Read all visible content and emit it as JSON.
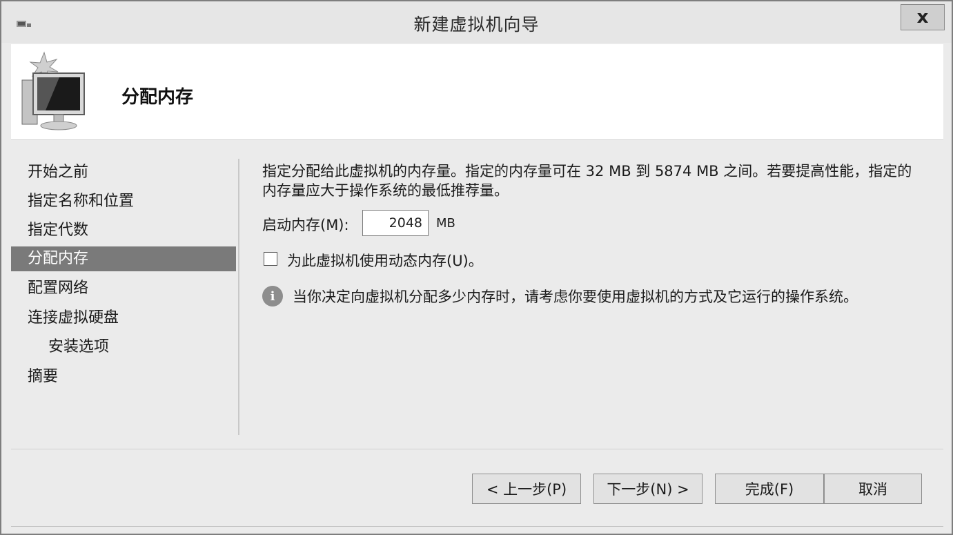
{
  "window": {
    "title": "新建虚拟机向导",
    "close_label": "x"
  },
  "header": {
    "title": "分配内存"
  },
  "nav": {
    "items": [
      {
        "label": "开始之前",
        "active": false,
        "sub": false
      },
      {
        "label": "指定名称和位置",
        "active": false,
        "sub": false
      },
      {
        "label": "指定代数",
        "active": false,
        "sub": false
      },
      {
        "label": "分配内存",
        "active": true,
        "sub": false
      },
      {
        "label": "配置网络",
        "active": false,
        "sub": false
      },
      {
        "label": "连接虚拟硬盘",
        "active": false,
        "sub": false
      },
      {
        "label": "安装选项",
        "active": false,
        "sub": true
      },
      {
        "label": "摘要",
        "active": false,
        "sub": false
      }
    ]
  },
  "main": {
    "description": "指定分配给此虚拟机的内存量。指定的内存量可在 32 MB 到 5874 MB 之间。若要提高性能，指定的内存量应大于操作系统的最低推荐量。",
    "startup_memory_label": "启动内存(M):",
    "startup_memory_value": "2048",
    "memory_unit": "MB",
    "dynamic_memory_label": "为此虚拟机使用动态内存(U)。",
    "dynamic_memory_checked": false,
    "info_text": "当你决定向虚拟机分配多少内存时，请考虑你要使用虚拟机的方式及它运行的操作系统。"
  },
  "buttons": {
    "previous": "< 上一步(P)",
    "next": "下一步(N) >",
    "finish": "完成(F)",
    "cancel": "取消"
  },
  "icons": {
    "title": "hyperv-app-icon",
    "header": "new-vm-monitor-icon",
    "info": "info-icon"
  }
}
